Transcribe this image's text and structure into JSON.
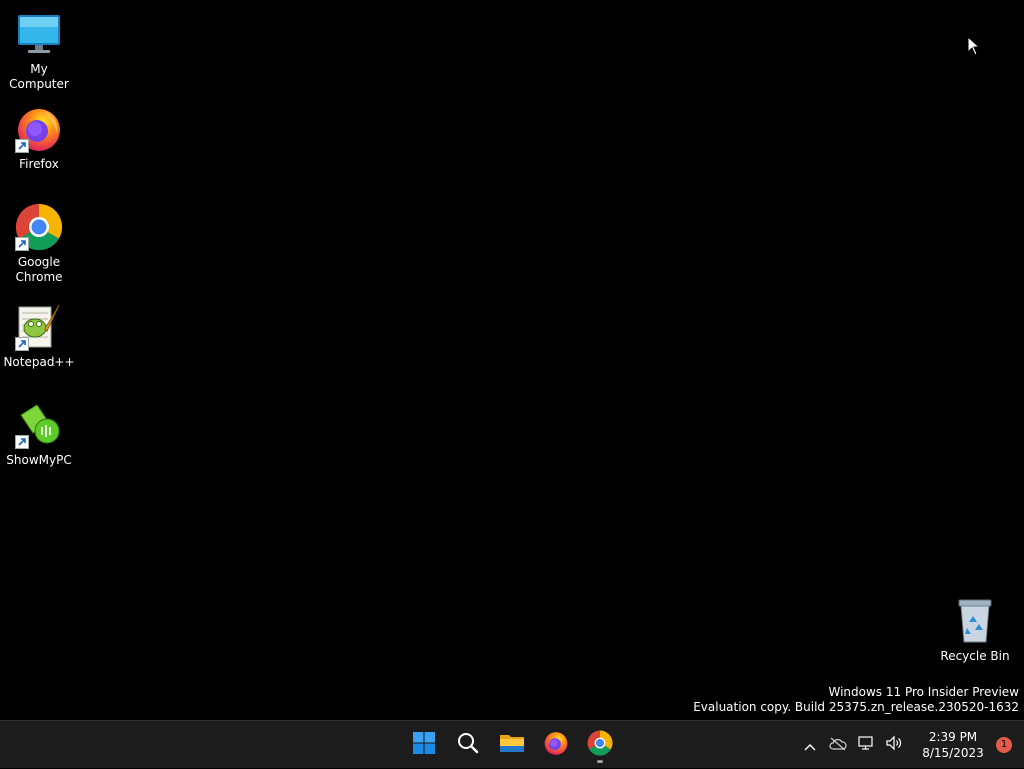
{
  "desktop": {
    "icons": [
      {
        "label": "My Computer",
        "icon": "monitor-icon"
      },
      {
        "label": "Firefox",
        "icon": "firefox-icon"
      },
      {
        "label": "Google Chrome",
        "icon": "chrome-icon"
      },
      {
        "label": "Notepad++",
        "icon": "notepadpp-icon"
      },
      {
        "label": "ShowMyPC",
        "icon": "showmypc-icon"
      }
    ],
    "recycle_bin": {
      "label": "Recycle Bin",
      "icon": "recycle-bin-icon"
    },
    "watermark": {
      "line1": "Windows 11 Pro Insider Preview",
      "line2": "Evaluation copy. Build 25375.zn_release.230520-1632"
    }
  },
  "taskbar": {
    "pinned": [
      {
        "name": "Start",
        "icon": "windows-start-icon"
      },
      {
        "name": "Search",
        "icon": "search-icon"
      },
      {
        "name": "File Explorer",
        "icon": "file-explorer-icon"
      },
      {
        "name": "Firefox",
        "icon": "firefox-icon"
      },
      {
        "name": "Google Chrome",
        "icon": "chrome-icon",
        "running": true
      }
    ],
    "tray": {
      "icons": [
        "chevron-up-icon",
        "onedrive-offline-icon",
        "network-icon",
        "volume-icon"
      ],
      "time": "2:39 PM",
      "date": "8/15/2023",
      "notification_count": "1"
    }
  },
  "colors": {
    "taskbar_bg": "#1c1c1c",
    "notification_badge": "#e45b4a",
    "windows_blue": "#0078d4"
  }
}
